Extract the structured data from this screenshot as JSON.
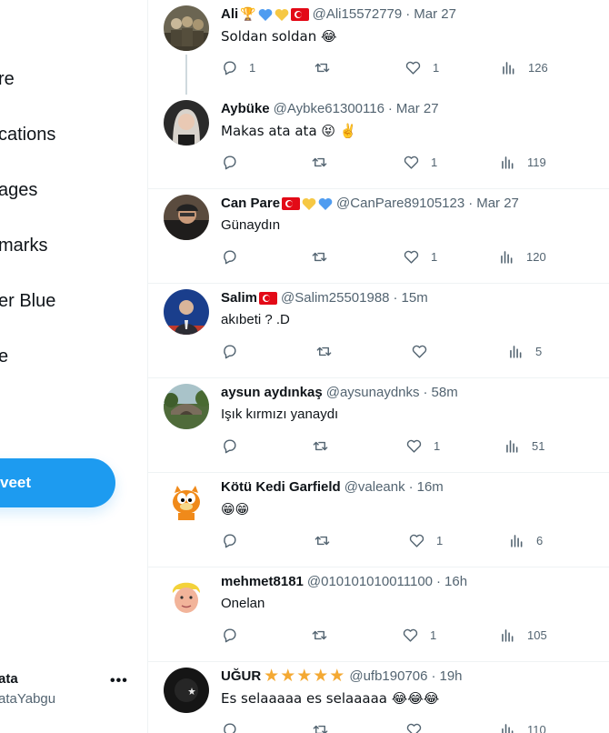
{
  "sidebar": {
    "items": [
      {
        "label": "re"
      },
      {
        "label": "cations"
      },
      {
        "label": "ages"
      },
      {
        "label": "marks"
      },
      {
        "label": "er Blue"
      },
      {
        "label": "e"
      }
    ],
    "tweet_button": "veet",
    "account": {
      "name": "ata",
      "handle": "ataYabgu"
    }
  },
  "tweets": [
    {
      "name": "Ali",
      "handle": "@Ali15572779",
      "time": "Mar 27",
      "text": "Soldan soldan 😂",
      "replies": "1",
      "retweets": "",
      "likes": "1",
      "views": "126"
    },
    {
      "name": "Aybüke",
      "handle": "@Aybke61300116",
      "time": "Mar 27",
      "text": "Makas ata ata 😝 ✌️",
      "replies": "",
      "retweets": "",
      "likes": "1",
      "views": "119"
    },
    {
      "name": "Can Pare",
      "handle": "@CanPare89105123",
      "time": "Mar 27",
      "text": "Günaydın",
      "replies": "",
      "retweets": "",
      "likes": "1",
      "views": "120"
    },
    {
      "name": "Salim",
      "handle": "@Salim25501988",
      "time": "15m",
      "text": "akıbeti ? .D",
      "replies": "",
      "retweets": "",
      "likes": "",
      "views": "5"
    },
    {
      "name": "aysun aydınkaş",
      "handle": "@aysunaydnks",
      "time": "58m",
      "text": "Işık kırmızı yanaydı",
      "replies": "",
      "retweets": "",
      "likes": "1",
      "views": "51"
    },
    {
      "name": "Kötü Kedi Garfield",
      "handle": "@valeank",
      "time": "16m",
      "text": "😁😁",
      "replies": "",
      "retweets": "",
      "likes": "1",
      "views": "6"
    },
    {
      "name": "mehmet8181",
      "handle": "@010101010011100",
      "time": "16h",
      "text": "Onelan",
      "replies": "",
      "retweets": "",
      "likes": "1",
      "views": "105"
    },
    {
      "name": "UĞUR",
      "handle": "@ufb190706",
      "time": "19h",
      "text": "Es selaaaaa es selaaaaa 😂😂😂",
      "replies": "",
      "retweets": "",
      "likes": "",
      "views": "110"
    }
  ],
  "badges": {
    "ali": "🏆",
    "ugur": "★★★★★"
  },
  "colors": {
    "accent": "#1d9bf0",
    "secondary_text": "#536471",
    "border": "#eff3f4",
    "turkish_flag": "#e30a17",
    "star": "#f4a933"
  }
}
